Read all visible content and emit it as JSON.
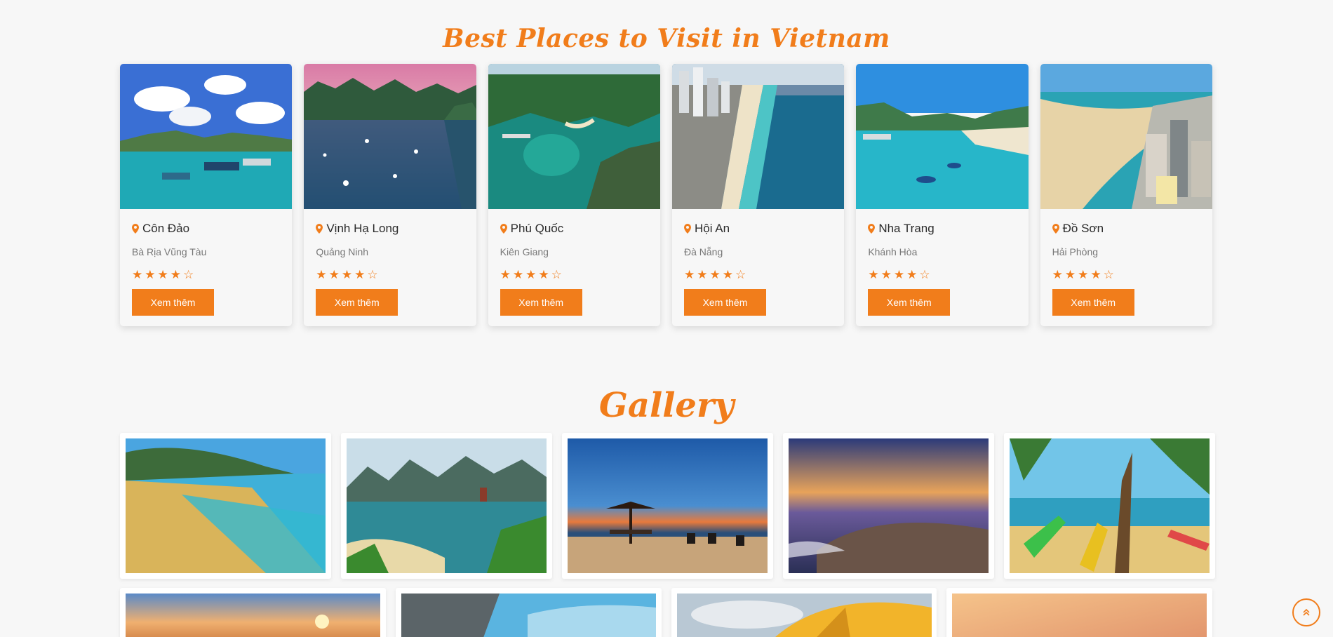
{
  "places_section": {
    "title": "Best Places to Visit in Vietnam",
    "button_label": "Xem thêm",
    "cards": [
      {
        "name": "Côn Đảo",
        "region": "Bà Rịa Vũng Tàu",
        "rating": 4,
        "max_rating": 5
      },
      {
        "name": "Vịnh Hạ Long",
        "region": "Quảng Ninh",
        "rating": 4,
        "max_rating": 5
      },
      {
        "name": "Phú Quốc",
        "region": "Kiên Giang",
        "rating": 4,
        "max_rating": 5
      },
      {
        "name": "Hội An",
        "region": "Đà Nẵng",
        "rating": 4,
        "max_rating": 5
      },
      {
        "name": "Nha Trang",
        "region": "Khánh Hòa",
        "rating": 4,
        "max_rating": 5
      },
      {
        "name": "Đồ Sơn",
        "region": "Hải Phòng",
        "rating": 4,
        "max_rating": 5
      }
    ]
  },
  "gallery_section": {
    "title": "Gallery"
  },
  "icons": {
    "location": "map-pin-icon",
    "star_filled": "star-filled-icon",
    "star_empty": "star-empty-icon",
    "scroll_top": "chevron-double-up-icon"
  },
  "colors": {
    "accent": "#f17d1b",
    "background": "#f7f7f7"
  }
}
